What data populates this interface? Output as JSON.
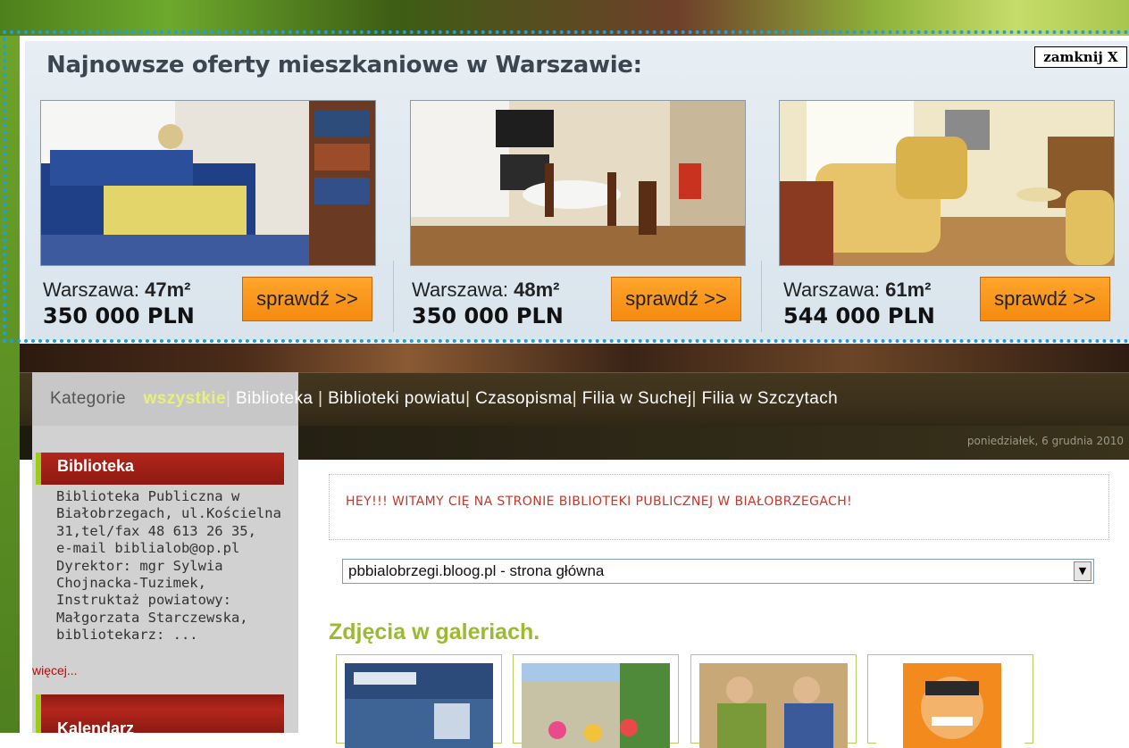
{
  "ad": {
    "title": "Najnowsze oferty mieszkaniowe w Warszawie:",
    "close_label": "zamknij X",
    "offers": [
      {
        "city": "Warszawa:",
        "area": "47m²",
        "price": "350 000 PLN",
        "button": "sprawdź >>"
      },
      {
        "city": "Warszawa:",
        "area": "48m²",
        "price": "350 000 PLN",
        "button": "sprawdź >>"
      },
      {
        "city": "Warszawa:",
        "area": "61m²",
        "price": "544 000 PLN",
        "button": "sprawdź >>"
      }
    ]
  },
  "nav": {
    "label": "Kategorie",
    "items": [
      "wszystkie",
      "Biblioteka",
      "Biblioteki powiatu",
      "Czasopisma",
      "Filia w Suchej",
      "Filia w Szczytach"
    ]
  },
  "date": "poniedziałek, 6 grudnia 2010",
  "sidebar": {
    "section1_title": "Biblioteka",
    "section1_lines": [
      "Biblioteka Publiczna w",
      "Białobrzegach, ul.Kościelna",
      "31,tel/fax 48 613 26 35,",
      "e-mail biblialob@op.pl",
      "Dyrektor: mgr Sylwia",
      "Chojnacka-Tuzimek,",
      "Instruktaż powiatowy:",
      "Małgorzata Starczewska,",
      "bibliotekarz: ..."
    ],
    "more": "więcej...",
    "section2_title": "Kalendarz"
  },
  "main": {
    "welcome": "HEY!!! WITAMY CIĘ NA STRONIE BIBLIOTEKI PUBLICZNEJ W BIAŁOBRZEGACH!",
    "select_value": "pbbialobrzegi.bloog.pl - strona główna",
    "gallery_title": "Zdjęcia w galeriach."
  },
  "colors": {
    "ad_border": "#1aa0e6",
    "button_orange": "#f58a10",
    "sidebar_header": "#b3261c",
    "accent_green": "#9bbb2e",
    "welcome_red": "#c0392b"
  }
}
